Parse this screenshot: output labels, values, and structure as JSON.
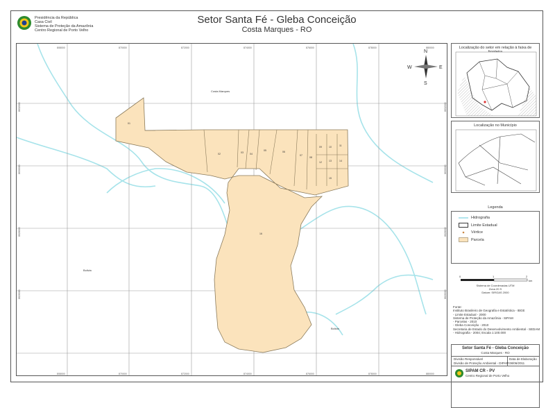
{
  "header": {
    "institution": [
      "Presidência da República",
      "Casa Civil",
      "Sistema de Proteção da Amazônia",
      "Centro Regional de Porto Velho"
    ],
    "title": "Setor Santa Fé - Gleba Conceição",
    "subtitle": "Costa Marques - RO"
  },
  "map": {
    "place_labels": [
      "Costa Marques",
      "Bolivia",
      "Bolivia"
    ],
    "parcel_labels": [
      "01",
      "02",
      "03",
      "04",
      "05",
      "06",
      "07",
      "08",
      "09",
      "10",
      "11",
      "12",
      "13",
      "14",
      "15",
      "16"
    ],
    "x_ticks": [
      "808000",
      "870000",
      "872000",
      "874000",
      "876000",
      "878000",
      "880000"
    ],
    "y_ticks": [
      "8632000",
      "8630000",
      "8628000",
      "8626000"
    ],
    "north": {
      "n": "N",
      "s": "S",
      "e": "E",
      "w": "W"
    },
    "colors": {
      "parcel_fill": "#fbe3bc",
      "parcel_stroke": "#8a7a5a",
      "river": "#a6e3ea",
      "grid": "#9a9a9a"
    }
  },
  "side": {
    "loc_frontier_title": "Localização do setor em relação à faixa de fronteira",
    "loc_municipio_title": "Localização no Município",
    "legend_title": "Legenda",
    "legend": [
      {
        "label": "Hidrografia",
        "symbol": "river-line"
      },
      {
        "label": "Limite Estadual",
        "symbol": "state-box"
      },
      {
        "label": "Vértice",
        "symbol": "vertex-dot"
      },
      {
        "label": "Parcela",
        "symbol": "parcel-fill"
      }
    ],
    "scale_labels": [
      "0",
      "1",
      "2"
    ],
    "scale_unit": "km",
    "projection": [
      "Sistema de Coordenadas UTM",
      "Zona 20 S",
      "Datum: SIRGAS 2000"
    ],
    "sources_title": "Fonte:",
    "sources": [
      "Instituto Brasileiro de Geografia e Estatística - IBGE",
      "- Limite Estadual - 2000",
      "Sistema de Proteção da Amazônia - SIPAM",
      "- Parcelas - 2010",
      "- Gleba Conceição - 2010",
      "Secretaria de Estado do Desenvolvimento Ambiental - SEDAM",
      "- Hidrografia - 2004; Escala 1:100.000"
    ],
    "title_box": {
      "title": "Setor Santa Fé - Gleba Conceição",
      "sub": "Costa Marques - RO",
      "col1_head": "Divisão Responsável",
      "col2_head": "Data de Elaboração",
      "col1_val": "Divisão de Proteção Ambiental - DIPAM",
      "col2_val": "08/06/2011",
      "org": "SIPAM CR - PV",
      "org_sub": "Centro Regional de Porto Velho"
    }
  }
}
